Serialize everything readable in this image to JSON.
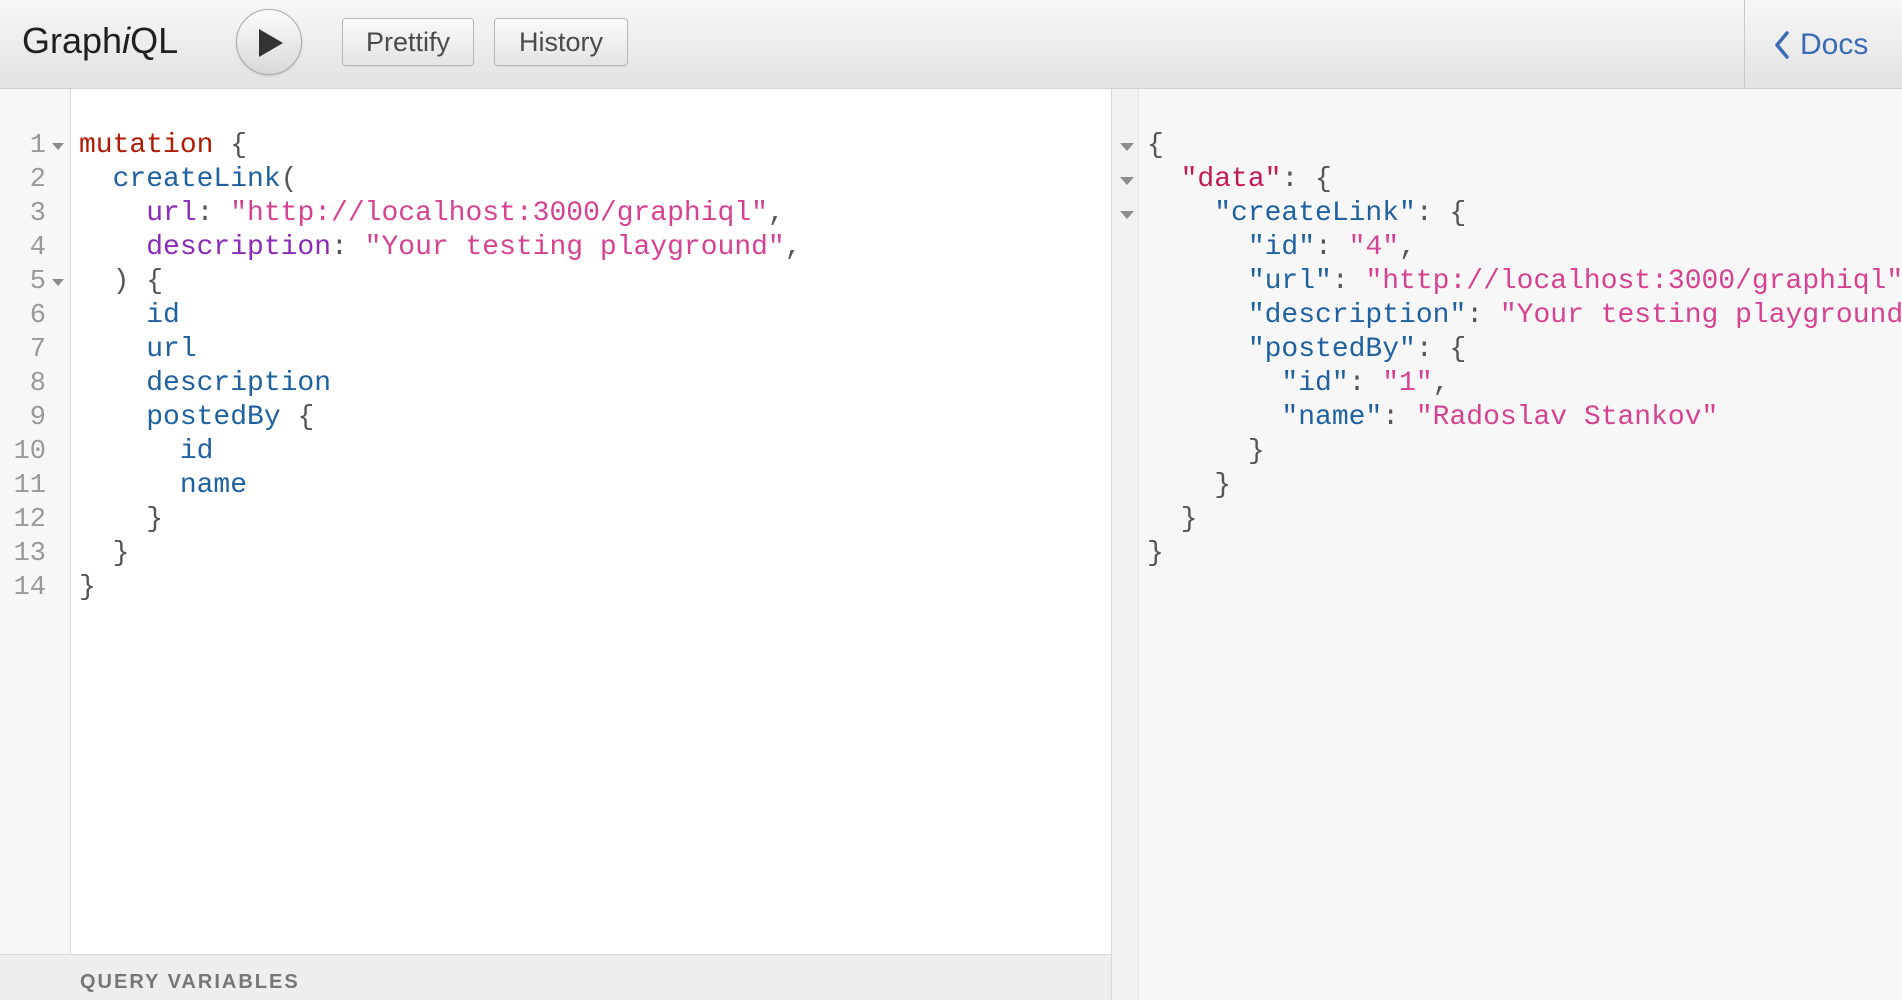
{
  "toolbar": {
    "logo_pre": "Graph",
    "logo_ital": "i",
    "logo_post": "QL",
    "run_icon": "play-icon",
    "prettify_label": "Prettify",
    "history_label": "History",
    "docs_label": "Docs",
    "docs_icon": "chevron-left-icon"
  },
  "query_editor": {
    "lines": [
      {
        "n": "1",
        "fold": true,
        "tokens": [
          {
            "t": "mutation",
            "c": "k"
          },
          {
            "t": " {",
            "c": "p"
          }
        ]
      },
      {
        "n": "2",
        "fold": false,
        "tokens": [
          {
            "t": "  createLink",
            "c": "d"
          },
          {
            "t": "(",
            "c": "p"
          }
        ]
      },
      {
        "n": "3",
        "fold": false,
        "tokens": [
          {
            "t": "    url",
            "c": "a"
          },
          {
            "t": ": ",
            "c": "p"
          },
          {
            "t": "\"http://localhost:3000/graphiql\"",
            "c": "s"
          },
          {
            "t": ",",
            "c": "p"
          }
        ]
      },
      {
        "n": "4",
        "fold": false,
        "tokens": [
          {
            "t": "    description",
            "c": "a"
          },
          {
            "t": ": ",
            "c": "p"
          },
          {
            "t": "\"Your testing playground\"",
            "c": "s"
          },
          {
            "t": ",",
            "c": "p"
          }
        ]
      },
      {
        "n": "5",
        "fold": true,
        "tokens": [
          {
            "t": "  ) {",
            "c": "p"
          }
        ]
      },
      {
        "n": "6",
        "fold": false,
        "tokens": [
          {
            "t": "    id",
            "c": "d"
          }
        ]
      },
      {
        "n": "7",
        "fold": false,
        "tokens": [
          {
            "t": "    url",
            "c": "d"
          }
        ]
      },
      {
        "n": "8",
        "fold": false,
        "tokens": [
          {
            "t": "    description",
            "c": "d"
          }
        ]
      },
      {
        "n": "9",
        "fold": false,
        "tokens": [
          {
            "t": "    postedBy",
            "c": "d"
          },
          {
            "t": " {",
            "c": "p"
          }
        ]
      },
      {
        "n": "10",
        "fold": false,
        "tokens": [
          {
            "t": "      id",
            "c": "d"
          }
        ]
      },
      {
        "n": "11",
        "fold": false,
        "tokens": [
          {
            "t": "      name",
            "c": "d"
          }
        ]
      },
      {
        "n": "12",
        "fold": false,
        "tokens": [
          {
            "t": "    }",
            "c": "p"
          }
        ]
      },
      {
        "n": "13",
        "fold": false,
        "tokens": [
          {
            "t": "  }",
            "c": "p"
          }
        ]
      },
      {
        "n": "14",
        "fold": false,
        "tokens": [
          {
            "t": "}",
            "c": "p"
          }
        ]
      }
    ]
  },
  "variables_panel": {
    "label": "QUERY VARIABLES"
  },
  "result_viewer": {
    "lines": [
      {
        "fold": true,
        "tokens": [
          {
            "t": "{",
            "c": "p"
          }
        ]
      },
      {
        "fold": true,
        "tokens": [
          {
            "t": "  ",
            "c": "p"
          },
          {
            "t": "\"data\"",
            "c": "k2"
          },
          {
            "t": ": {",
            "c": "p"
          }
        ]
      },
      {
        "fold": true,
        "tokens": [
          {
            "t": "    \"createLink\"",
            "c": "d"
          },
          {
            "t": ": {",
            "c": "p"
          }
        ]
      },
      {
        "fold": false,
        "tokens": [
          {
            "t": "      \"id\"",
            "c": "d"
          },
          {
            "t": ": ",
            "c": "p"
          },
          {
            "t": "\"4\"",
            "c": "s"
          },
          {
            "t": ",",
            "c": "p"
          }
        ]
      },
      {
        "fold": false,
        "tokens": [
          {
            "t": "      \"url\"",
            "c": "d"
          },
          {
            "t": ": ",
            "c": "p"
          },
          {
            "t": "\"http://localhost:3000/graphiql\"",
            "c": "s"
          },
          {
            "t": ",",
            "c": "p"
          }
        ]
      },
      {
        "fold": false,
        "tokens": [
          {
            "t": "      \"description\"",
            "c": "d"
          },
          {
            "t": ": ",
            "c": "p"
          },
          {
            "t": "\"Your testing playground\"",
            "c": "s"
          },
          {
            "t": ",",
            "c": "p"
          }
        ]
      },
      {
        "fold": false,
        "tokens": [
          {
            "t": "      \"postedBy\"",
            "c": "d"
          },
          {
            "t": ": {",
            "c": "p"
          }
        ]
      },
      {
        "fold": false,
        "tokens": [
          {
            "t": "        \"id\"",
            "c": "d"
          },
          {
            "t": ": ",
            "c": "p"
          },
          {
            "t": "\"1\"",
            "c": "s"
          },
          {
            "t": ",",
            "c": "p"
          }
        ]
      },
      {
        "fold": false,
        "tokens": [
          {
            "t": "        \"name\"",
            "c": "d"
          },
          {
            "t": ": ",
            "c": "p"
          },
          {
            "t": "\"Radoslav Stankov\"",
            "c": "s"
          }
        ]
      },
      {
        "fold": false,
        "tokens": [
          {
            "t": "      }",
            "c": "p"
          }
        ]
      },
      {
        "fold": false,
        "tokens": [
          {
            "t": "    }",
            "c": "p"
          }
        ]
      },
      {
        "fold": false,
        "tokens": [
          {
            "t": "  }",
            "c": "p"
          }
        ]
      },
      {
        "fold": false,
        "tokens": [
          {
            "t": "}",
            "c": "p"
          }
        ]
      }
    ]
  },
  "colors": {
    "keyword": "#b11a04",
    "def": "#1f61a0",
    "attribute": "#8b2bb9",
    "string": "#d64292",
    "punctuation": "#555555",
    "result_key_data": "#c41a55",
    "docs_link": "#3a6cb3"
  }
}
